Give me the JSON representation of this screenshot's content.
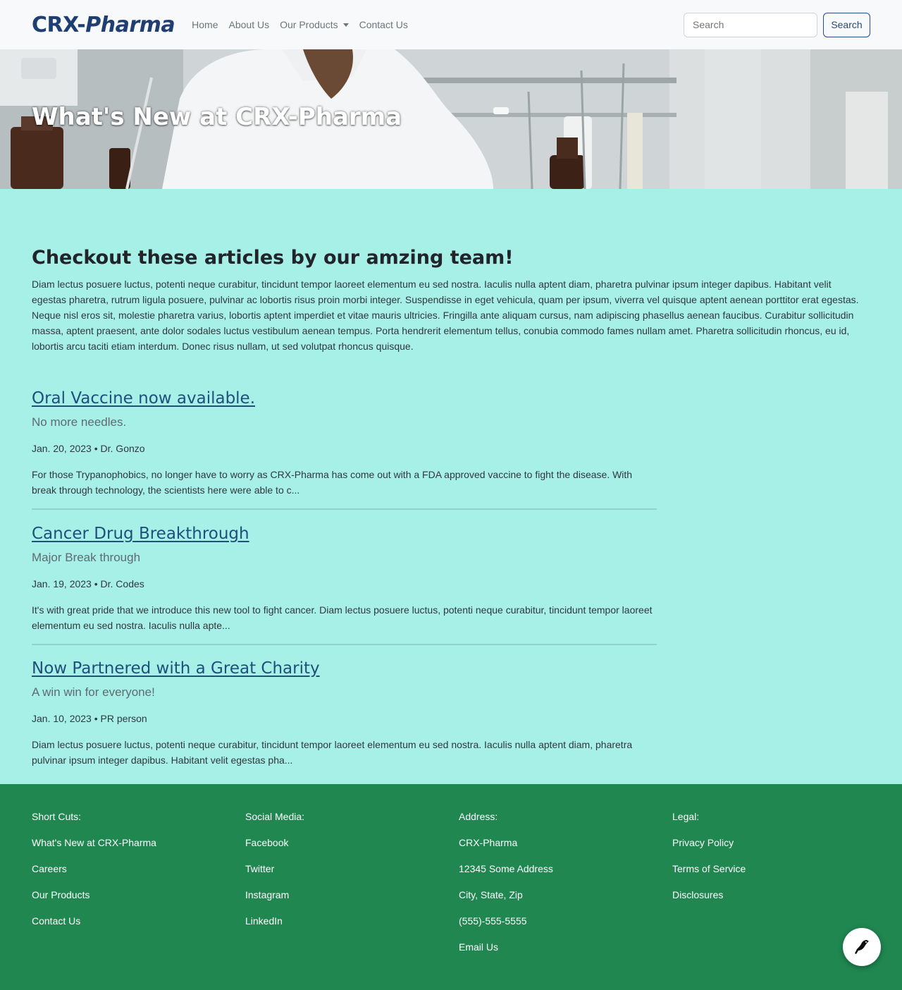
{
  "navbar": {
    "brand_part1": "CRX-",
    "brand_part2": "Pharma",
    "links": [
      "Home",
      "About Us",
      "Our Products",
      "Contact Us"
    ],
    "search_placeholder": "Search",
    "search_button": "Search"
  },
  "hero": {
    "title": "What's New at CRX-Pharma"
  },
  "intro": {
    "heading": "Checkout these articles by our amzing team!",
    "body": "Diam lectus posuere luctus, potenti neque curabitur, tincidunt tempor laoreet elementum eu sed nostra. Iaculis nulla aptent diam, pharetra pulvinar ipsum integer dapibus. Habitant velit egestas pharetra, rutrum ligula posuere, pulvinar ac lobortis risus proin morbi integer. Suspendisse in eget vehicula, quam per ipsum, viverra vel quisque aptent aenean porttitor erat egestas. Neque nisl eros sit, molestie pharetra varius, lobortis aptent imperdiet et vitae mauris ultricies. Fringilla ante aliquam cursus, nam adipiscing phasellus aenean faucibus. Curabitur sollicitudin massa, aptent praesent, ante dolor sodales luctus vestibulum aenean tempus. Porta hendrerit elementum tellus, conubia commodo fames nullam amet. Pharetra sollicitudin rhoncus, eu id, lobortis arcu taciti etiam interdum. Donec risus nullam, ut sed volutpat rhoncus quisque."
  },
  "articles": [
    {
      "title": "Oral Vaccine now available.",
      "subtitle": "No more needles.",
      "meta": "Jan. 20, 2023 • Dr. Gonzo",
      "excerpt": "For those Trypanophobics, no longer have to worry as CRX-Pharma has come out with a FDA approved vaccine to fight the disease. With break through technology, the scientists here were able to c..."
    },
    {
      "title": "Cancer Drug Breakthrough",
      "subtitle": "Major Break through",
      "meta": "Jan. 19, 2023 • Dr. Codes",
      "excerpt": "It's with great pride that we introduce this new tool to fight cancer. Diam lectus posuere luctus, potenti neque curabitur, tincidunt tempor laoreet elementum eu sed nostra. Iaculis nulla apte..."
    },
    {
      "title": "Now Partnered with a Great Charity",
      "subtitle": "A win win for everyone!",
      "meta": "Jan. 10, 2023 • PR person",
      "excerpt": "Diam lectus posuere luctus, potenti neque curabitur, tincidunt tempor laoreet elementum eu sed nostra. Iaculis nulla aptent diam, pharetra pulvinar ipsum integer dapibus. Habitant velit egestas pha..."
    }
  ],
  "footer": {
    "shortcuts": {
      "heading": "Short Cuts:",
      "items": [
        "What's New at CRX-Pharma",
        "Careers",
        "Our Products",
        "Contact Us"
      ]
    },
    "social": {
      "heading": "Social Media:",
      "items": [
        "Facebook",
        "Twitter",
        "Instagram",
        "LinkedIn"
      ]
    },
    "address": {
      "heading": "Address:",
      "items": [
        "CRX-Pharma",
        "12345 Some Address",
        "City, State, Zip",
        "(555)-555-5555",
        "Email Us"
      ]
    },
    "legal": {
      "heading": "Legal:",
      "items": [
        "Privacy Policy",
        "Terms of Service",
        "Disclosures"
      ]
    }
  },
  "fab_icon": "bird-icon",
  "colors": {
    "brand": "#1f3f73",
    "main_bg": "#a7f0e8",
    "footer_bg": "#208751",
    "link": "#1f4f7a"
  }
}
